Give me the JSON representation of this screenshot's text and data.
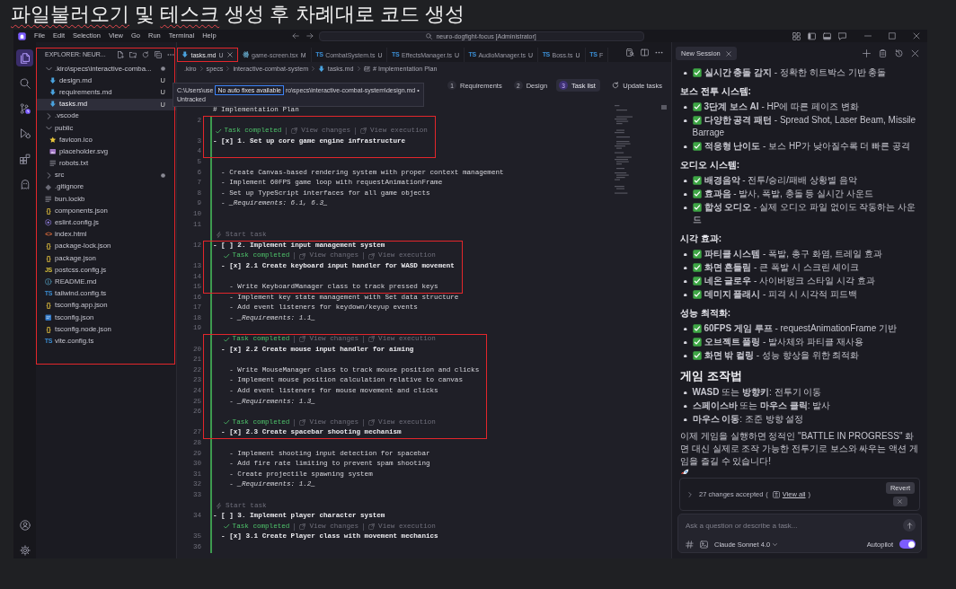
{
  "page_title": {
    "segments": [
      {
        "text": "파일불러오기",
        "misspelled": true
      },
      {
        "text": " 및 ",
        "misspelled": false
      },
      {
        "text": "테스크",
        "misspelled": true
      },
      {
        "text": " 생성 후 차례대로 코드 생성",
        "misspelled": false
      }
    ]
  },
  "titlebar": {
    "menu": [
      "File",
      "Edit",
      "Selection",
      "View",
      "Go",
      "Run",
      "Terminal",
      "Help"
    ],
    "search": "neuro-dogfight-focus [Administrator]"
  },
  "activity_bar": {
    "items": [
      {
        "kind": "files",
        "selected": true
      },
      {
        "kind": "search",
        "selected": false
      },
      {
        "kind": "source_control",
        "selected": false
      },
      {
        "kind": "run",
        "selected": false
      },
      {
        "kind": "extensions",
        "selected": false
      },
      {
        "kind": "kiro",
        "selected": false
      }
    ]
  },
  "explorer": {
    "title": "EXPLORER: NEUR...",
    "highlighted": true,
    "tree": [
      {
        "name": ".kiro\\specs\\interactive-comba...",
        "kind": "folder",
        "expanded": true,
        "modified": true,
        "selected": false,
        "children": [
          {
            "name": "design.md",
            "kind": "markdown",
            "status": "U",
            "modified": false,
            "selected": false
          },
          {
            "name": "requirements.md",
            "kind": "markdown",
            "status": "U",
            "modified": false,
            "selected": false
          },
          {
            "name": "tasks.md",
            "kind": "markdown",
            "status": "U",
            "modified": false,
            "selected": true
          }
        ]
      },
      {
        "name": ".vscode",
        "kind": "folder",
        "expanded": false,
        "modified": false,
        "selected": false
      },
      {
        "name": "public",
        "kind": "folder",
        "expanded": true,
        "modified": false,
        "selected": false,
        "children": [
          {
            "name": "favicon.ico",
            "kind": "star",
            "modified": false,
            "selected": false
          },
          {
            "name": "placeholder.svg",
            "kind": "image",
            "modified": false,
            "selected": false
          },
          {
            "name": "robots.txt",
            "kind": "text",
            "modified": false,
            "selected": false
          }
        ]
      },
      {
        "name": "src",
        "kind": "folder",
        "expanded": false,
        "modified": true,
        "selected": false
      },
      {
        "name": ".gitignore",
        "kind": "git",
        "modified": false,
        "selected": false
      },
      {
        "name": "bun.lockb",
        "kind": "text",
        "modified": false,
        "selected": false
      },
      {
        "name": "components.json",
        "kind": "json",
        "glyph": "{}",
        "modified": false,
        "selected": false
      },
      {
        "name": "eslint.config.js",
        "kind": "eslint",
        "modified": false,
        "selected": false
      },
      {
        "name": "index.html",
        "kind": "html",
        "glyph": "<>",
        "modified": false,
        "selected": false
      },
      {
        "name": "package-lock.json",
        "kind": "json",
        "glyph": "{}",
        "modified": false,
        "selected": false
      },
      {
        "name": "package.json",
        "kind": "json",
        "glyph": "{}",
        "modified": false,
        "selected": false
      },
      {
        "name": "postcss.config.js",
        "kind": "js",
        "glyph": "JS",
        "modified": false,
        "selected": false
      },
      {
        "name": "README.md",
        "kind": "info",
        "modified": false,
        "selected": false
      },
      {
        "name": "tailwind.config.ts",
        "kind": "ts",
        "glyph": "TS",
        "modified": false,
        "selected": false
      },
      {
        "name": "tsconfig.app.json",
        "kind": "json",
        "glyph": "{}",
        "modified": false,
        "selected": false
      },
      {
        "name": "tsconfig.json",
        "kind": "tsconfig",
        "modified": false,
        "selected": false
      },
      {
        "name": "tsconfig.node.json",
        "kind": "json",
        "glyph": "{}",
        "modified": false,
        "selected": false
      },
      {
        "name": "vite.config.ts",
        "kind": "ts",
        "glyph": "TS",
        "modified": false,
        "selected": false
      }
    ]
  },
  "editor": {
    "tabs": [
      {
        "label": "tasks.md",
        "status": "U",
        "kind": "markdown",
        "selected": true,
        "highlighted": true
      },
      {
        "label": "game-screen.tsx",
        "status": "M",
        "kind": "react",
        "selected": false,
        "highlighted": false
      },
      {
        "label": "CombatSystem.ts",
        "status": "U",
        "kind": "ts",
        "glyph": "TS",
        "selected": false,
        "highlighted": false
      },
      {
        "label": "EffectsManager.ts",
        "status": "U",
        "kind": "ts",
        "glyph": "TS",
        "selected": false,
        "highlighted": false
      },
      {
        "label": "AudioManager.ts",
        "status": "U",
        "kind": "ts",
        "glyph": "TS",
        "selected": false,
        "highlighted": false
      },
      {
        "label": "Boss.ts",
        "status": "U",
        "kind": "ts",
        "glyph": "TS",
        "selected": false,
        "highlighted": false
      },
      {
        "label": "F",
        "kind": "ts",
        "glyph": "TS",
        "selected": false,
        "highlighted": false
      }
    ],
    "breadcrumb": [
      {
        "text": ".kiro"
      },
      {
        "text": "specs"
      },
      {
        "text": "interactive-combat-system"
      },
      {
        "text": "tasks.md",
        "kind": "markdown"
      },
      {
        "text": "# Implementation Plan",
        "kind": "symbol"
      }
    ],
    "spec_steps": [
      {
        "number": "1",
        "label": "Requirements",
        "selected": false
      },
      {
        "number": "2",
        "label": "Design",
        "selected": false
      },
      {
        "number": "3",
        "label": "Task list",
        "selected": true
      }
    ],
    "update_button": "Update tasks",
    "tooltip": {
      "path_start": "C:\\Users\\use",
      "quick_fix": "No auto fixes available",
      "path_end": "ro\\specs\\interactive-combat-system\\design.md •",
      "status": "Untracked"
    },
    "blocks": [
      {
        "added": false,
        "highlighted": false,
        "rows": [
          {
            "kind": "line",
            "text": "# Implementation Plan"
          }
        ]
      },
      {
        "added": true,
        "highlighted": true,
        "rows": [
          {
            "kind": "line",
            "number": "2"
          },
          {
            "kind": "lens_done",
            "nested": false,
            "status": "Task completed",
            "actions": [
              "View changes",
              "View execution"
            ]
          },
          {
            "kind": "task",
            "number": "3",
            "text": "- [x] 1. Set up core game engine infrastructure"
          },
          {
            "kind": "line",
            "number": "4"
          }
        ]
      },
      {
        "added": true,
        "highlighted": false,
        "rows": [
          {
            "kind": "line",
            "number": "5"
          },
          {
            "kind": "line",
            "number": "6",
            "text": "  - Create Canvas-based rendering system with proper context management"
          },
          {
            "kind": "line",
            "number": "7",
            "text": "  - Implement 60FPS game loop with requestAnimationFrame"
          },
          {
            "kind": "line",
            "number": "8",
            "text": "  - Set up TypeScript interfaces for all game objects"
          },
          {
            "kind": "line",
            "number": "9",
            "text": "  - *_Requirements: 6.1, 6.3_*"
          },
          {
            "kind": "line",
            "number": "10"
          },
          {
            "kind": "line",
            "number": "11"
          },
          {
            "kind": "lens_start",
            "nested": false,
            "label": "Start task"
          }
        ]
      },
      {
        "added": true,
        "highlighted": true,
        "rows": [
          {
            "kind": "task",
            "number": "12",
            "text": "- [ ] 2. Implement input management system"
          },
          {
            "kind": "lens_done",
            "nested": true,
            "status": "Task completed",
            "actions": [
              "View changes",
              "View execution"
            ]
          },
          {
            "kind": "task",
            "number": "13",
            "text": "  - [x] 2.1 Create keyboard input handler for WASD movement"
          },
          {
            "kind": "line",
            "number": "14"
          },
          {
            "kind": "line",
            "number": "15",
            "text": "    - Write KeyboardManager class to track pressed keys"
          }
        ]
      },
      {
        "added": true,
        "highlighted": false,
        "rows": [
          {
            "kind": "line",
            "number": "16",
            "text": "    - Implement key state management with Set data structure"
          },
          {
            "kind": "line",
            "number": "17",
            "text": "    - Add event listeners for keydown/keyup events"
          },
          {
            "kind": "line",
            "number": "18",
            "text": "    - *_Requirements: 1.1_*"
          },
          {
            "kind": "line",
            "number": "19"
          }
        ]
      },
      {
        "added": true,
        "highlighted": true,
        "rows": [
          {
            "kind": "lens_done",
            "nested": true,
            "status": "Task completed",
            "actions": [
              "View changes",
              "View execution"
            ]
          },
          {
            "kind": "task",
            "number": "20",
            "text": "  - [x] 2.2 Create mouse input handler for aiming"
          },
          {
            "kind": "line",
            "number": "21"
          },
          {
            "kind": "line",
            "number": "22",
            "text": "    - Write MouseManager class to track mouse position and clicks"
          },
          {
            "kind": "line",
            "number": "23",
            "text": "    - Implement mouse position calculation relative to canvas"
          },
          {
            "kind": "line",
            "number": "24",
            "text": "    - Add event listeners for mouse movement and clicks"
          },
          {
            "kind": "line",
            "number": "25",
            "text": "    - *_Requirements: 1.3_*"
          },
          {
            "kind": "line",
            "number": "26"
          },
          {
            "kind": "lens_done",
            "nested": true,
            "status": "Task completed",
            "actions": [
              "View changes",
              "View execution"
            ]
          },
          {
            "kind": "task",
            "number": "27",
            "text": "  - [x] 2.3 Create spacebar shooting mechanism"
          }
        ]
      },
      {
        "added": true,
        "highlighted": false,
        "rows": [
          {
            "kind": "line",
            "number": "28"
          },
          {
            "kind": "line",
            "number": "29",
            "text": "    - Implement shooting input detection for spacebar"
          },
          {
            "kind": "line",
            "number": "30",
            "text": "    - Add fire rate limiting to prevent spam shooting"
          },
          {
            "kind": "line",
            "number": "31",
            "text": "    - Create projectile spawning system"
          },
          {
            "kind": "line",
            "number": "32",
            "text": "    - *_Requirements: 1.2_*"
          },
          {
            "kind": "line",
            "number": "33"
          },
          {
            "kind": "lens_start",
            "nested": false,
            "label": "Start task"
          },
          {
            "kind": "task",
            "number": "34",
            "text": "- [ ] 3. Implement player character system"
          },
          {
            "kind": "lens_done",
            "nested": true,
            "status": "Task completed",
            "actions": [
              "View changes",
              "View execution"
            ]
          },
          {
            "kind": "task",
            "number": "35",
            "text": "  - [x] 3.1 Create Player class with movement mechanics"
          },
          {
            "kind": "line",
            "number": "36"
          }
        ]
      }
    ]
  },
  "chat": {
    "tab": {
      "label": "New Session"
    },
    "blocks": [
      {
        "kind": "list",
        "items": [
          {
            "text": "**실시간 충돌 감지** - 정확한 히트박스 기반 충돌",
            "checked": true
          }
        ]
      },
      {
        "kind": "heading",
        "text": "보스 전투 시스템:"
      },
      {
        "kind": "list",
        "items": [
          {
            "text": "**3단계 보스 AI** - HP에 따른 페이즈 변화",
            "checked": true
          },
          {
            "text": "**다양한 공격 패턴** - Spread Shot, Laser Beam, Missile Barrage",
            "checked": true
          },
          {
            "text": "**적응형 난이도** - 보스 HP가 낮아질수록 더 빠른 공격",
            "checked": true
          }
        ]
      },
      {
        "kind": "heading",
        "text": "오디오 시스템:"
      },
      {
        "kind": "list",
        "items": [
          {
            "text": "**배경음악** - 전투/승리/패배 상황별 음악",
            "checked": true
          },
          {
            "text": "**효과음** - 발사, 폭발, 충돌 등 실시간 사운드",
            "checked": true
          },
          {
            "text": "**합성 오디오** - 실제 오디오 파일 없이도 작동하는 사운드",
            "checked": true
          }
        ]
      },
      {
        "kind": "heading",
        "text": "시각 효과:"
      },
      {
        "kind": "list",
        "items": [
          {
            "text": "**파티클 시스템** - 폭발, 총구 화염, 트레일 효과",
            "checked": true
          },
          {
            "text": "**화면 흔들림** - 큰 폭발 시 스크린 셰이크",
            "checked": true
          },
          {
            "text": "**네온 글로우** - 사이버펑크 스타일 시각 효과",
            "checked": true
          },
          {
            "text": "**데미지 플래시** - 피격 시 시각적 피드백",
            "checked": true
          }
        ]
      },
      {
        "kind": "heading",
        "text": "성능 최적화:"
      },
      {
        "kind": "list",
        "items": [
          {
            "text": "**60FPS 게임 루프** - requestAnimationFrame 기반",
            "checked": true
          },
          {
            "text": "**오브젝트 풀링** - 발사체와 파티클 재사용",
            "checked": true
          },
          {
            "text": "**화면 밖 컬링** - 성능 향상을 위한 최적화",
            "checked": true
          }
        ]
      },
      {
        "kind": "title",
        "text": "게임 조작법"
      },
      {
        "kind": "list",
        "items": [
          {
            "text": "**WASD** 또는 **방향키**: 전투기 이동",
            "checked": false
          },
          {
            "text": "**스페이스바** 또는 **마우스 클릭**: 발사",
            "checked": false
          },
          {
            "text": "**마우스 이동**: 조준 방향 설정",
            "checked": false
          }
        ]
      },
      {
        "kind": "paragraph",
        "text": "이제 게임을 실행하면 정적인 \"BATTLE IN PROGRESS\" 화면 대신 실제로 조작 가능한 전투기로 보스와 싸우는 액션 게임을 즐길 수 있습니다!"
      }
    ],
    "changes": {
      "summary": "27 changes accepted",
      "open": "(",
      "link": "View all",
      "close": ")",
      "revert": "Revert",
      "expanded": false
    },
    "input": {
      "placeholder": "Ask a question or describe a task..."
    },
    "model": {
      "label": "Claude Sonnet 4.0"
    },
    "autopilot": {
      "label": "Autopilot",
      "on": true
    }
  }
}
